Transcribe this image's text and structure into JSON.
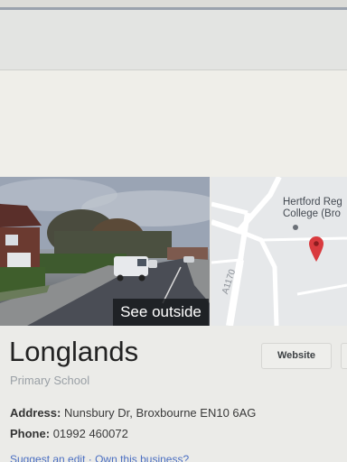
{
  "street_view": {
    "button_label": "See outside"
  },
  "map": {
    "place_label_line1": "Hertford Reg",
    "place_label_line2": "College (Bro",
    "road_label": "A1170"
  },
  "place": {
    "name": "Longlands",
    "category": "Primary School",
    "website_label": "Website",
    "address_label": "Address:",
    "address_value": "Nunsbury Dr, Broxbourne EN10 6AG",
    "phone_label": "Phone:",
    "phone_value": "01992 460072"
  },
  "footer_links": {
    "suggest": "Suggest an edit",
    "separator": "·",
    "own": "Own this business?"
  },
  "colors": {
    "link": "#4b6fc2",
    "pin": "#d93a3e",
    "subtitle": "#9aa0a6"
  }
}
